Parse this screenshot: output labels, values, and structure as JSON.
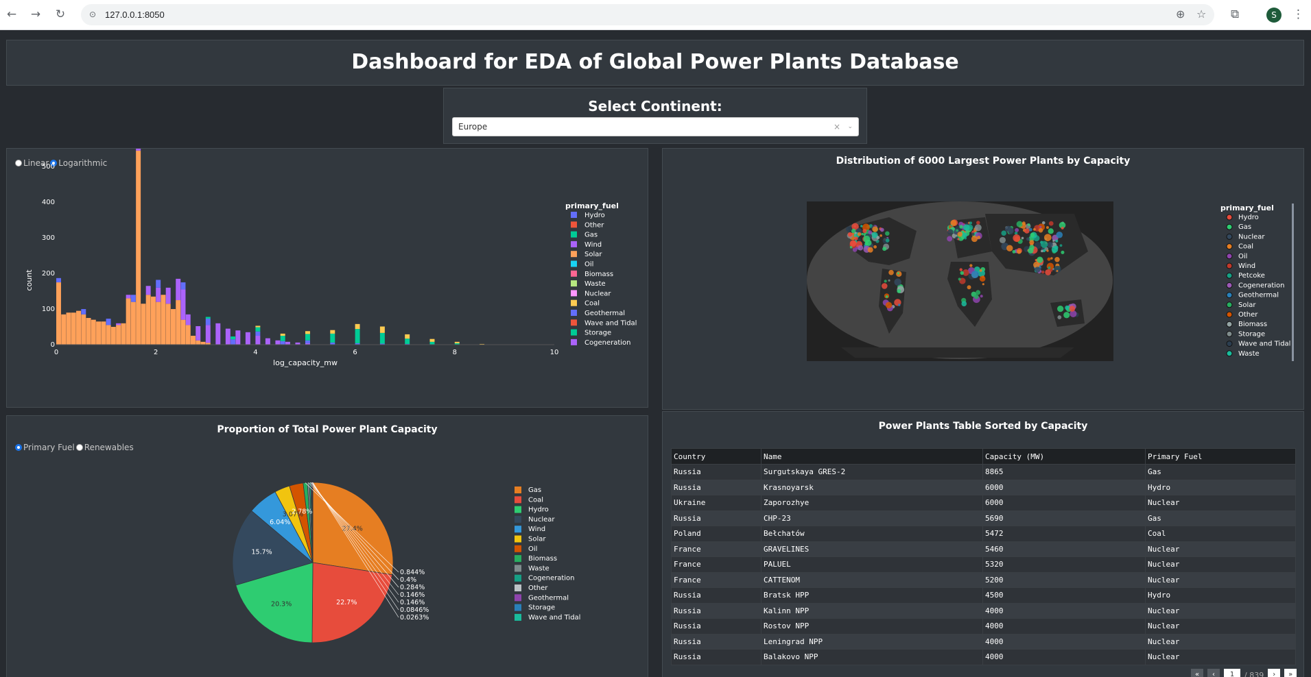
{
  "browser": {
    "url": "127.0.0.1:8050",
    "avatar_letter": "S"
  },
  "header": {
    "title": "Dashboard for EDA of Global Power Plants Database"
  },
  "continent_select": {
    "label": "Select Continent:",
    "value": "Europe",
    "clear": "×",
    "arrow": "⌄"
  },
  "histogram": {
    "radio_options": [
      {
        "label": "Linear",
        "selected": false
      },
      {
        "label": "Logarithmic",
        "selected": true
      }
    ],
    "legend_title": "primary_fuel",
    "xlabel": "log_capacity_mw",
    "ylabel": "count",
    "xticks": [
      "0",
      "2",
      "4",
      "6",
      "8",
      "10"
    ],
    "yticks": [
      "0",
      "100",
      "200",
      "300",
      "400",
      "500"
    ],
    "legend": [
      {
        "name": "Hydro",
        "color": "#636efa"
      },
      {
        "name": "Other",
        "color": "#ef553b"
      },
      {
        "name": "Gas",
        "color": "#00cc96"
      },
      {
        "name": "Wind",
        "color": "#ab63fa"
      },
      {
        "name": "Solar",
        "color": "#ffa15a"
      },
      {
        "name": "Oil",
        "color": "#19d3f3"
      },
      {
        "name": "Biomass",
        "color": "#ff6692"
      },
      {
        "name": "Waste",
        "color": "#b6e880"
      },
      {
        "name": "Nuclear",
        "color": "#ff97ff"
      },
      {
        "name": "Coal",
        "color": "#fecb52"
      },
      {
        "name": "Geothermal",
        "color": "#636efa"
      },
      {
        "name": "Wave and Tidal",
        "color": "#ef553b"
      },
      {
        "name": "Storage",
        "color": "#00cc96"
      },
      {
        "name": "Cogeneration",
        "color": "#ab63fa"
      }
    ]
  },
  "chart_data": [
    {
      "type": "bar",
      "title": "",
      "xlabel": "log_capacity_mw",
      "ylabel": "count",
      "xlim": [
        0,
        10
      ],
      "ylim": [
        0,
        560
      ],
      "bin_width": 0.1,
      "series": [
        {
          "name": "Solar",
          "color": "#ffa15a",
          "bin_starts": [
            0.0,
            0.1,
            0.2,
            0.3,
            0.4,
            0.5,
            0.6,
            0.7,
            0.8,
            0.9,
            1.0,
            1.1,
            1.2,
            1.3,
            1.4,
            1.5,
            1.6,
            1.7,
            1.8,
            1.9,
            2.0,
            2.1,
            2.2,
            2.3,
            2.4,
            2.5,
            2.6,
            2.7,
            2.8,
            2.9,
            3.0
          ],
          "values": [
            175,
            85,
            90,
            90,
            95,
            85,
            75,
            70,
            65,
            65,
            55,
            50,
            55,
            60,
            130,
            120,
            545,
            115,
            140,
            135,
            120,
            140,
            115,
            100,
            125,
            70,
            55,
            25,
            12,
            8,
            5
          ]
        },
        {
          "name": "Wind",
          "color": "#ab63fa",
          "bin_starts": [
            1.2,
            1.4,
            1.6,
            1.8,
            2.0,
            2.2,
            2.4,
            2.5,
            2.6,
            2.8,
            3.0,
            3.2,
            3.4,
            3.6,
            3.8,
            4.0,
            4.2,
            4.4,
            4.6,
            4.8,
            5.0
          ],
          "values": [
            5,
            10,
            10,
            25,
            40,
            45,
            60,
            85,
            30,
            40,
            50,
            60,
            45,
            40,
            35,
            25,
            18,
            12,
            8,
            6,
            4
          ]
        },
        {
          "name": "Hydro",
          "color": "#636efa",
          "bin_starts": [
            0.0,
            0.5,
            1.0,
            1.5,
            2.0,
            2.5,
            3.0,
            3.5,
            4.0,
            4.5,
            5.0,
            5.5,
            6.0,
            6.5,
            7.0
          ],
          "values": [
            12,
            15,
            18,
            20,
            22,
            20,
            18,
            15,
            12,
            10,
            8,
            6,
            4,
            3,
            2
          ]
        },
        {
          "name": "Gas",
          "color": "#00cc96",
          "bin_starts": [
            3.0,
            3.5,
            4.0,
            4.5,
            5.0,
            5.5,
            6.0,
            6.5,
            7.0,
            7.5,
            8.0
          ],
          "values": [
            5,
            8,
            12,
            15,
            18,
            25,
            40,
            30,
            15,
            8,
            4
          ]
        },
        {
          "name": "Coal",
          "color": "#fecb52",
          "bin_starts": [
            4.0,
            4.5,
            5.0,
            5.5,
            6.0,
            6.5,
            7.0,
            7.5,
            8.0,
            8.5
          ],
          "values": [
            4,
            6,
            8,
            10,
            14,
            18,
            12,
            8,
            4,
            2
          ]
        }
      ]
    },
    {
      "type": "pie",
      "title": "Proportion of Total Power Plant Capacity",
      "labels": [
        "Gas",
        "Coal",
        "Hydro",
        "Nuclear",
        "Wind",
        "Solar",
        "Oil",
        "Biomass",
        "Waste",
        "Cogeneration",
        "Other",
        "Geothermal",
        "Storage",
        "Wave and Tidal"
      ],
      "values": [
        27.4,
        22.7,
        20.3,
        15.7,
        6.04,
        3.07,
        2.78,
        0.844,
        0.4,
        0.284,
        0.146,
        0.146,
        0.0846,
        0.0263
      ],
      "value_labels": [
        "27.4%",
        "22.7%",
        "20.3%",
        "15.7%",
        "6.04%",
        "3.07%",
        "2.78%",
        "0.844%",
        "0.4%",
        "0.284%",
        "0.146%",
        "0.146%",
        "0.0846%",
        "0.0263%"
      ],
      "colors": [
        "#e67e22",
        "#e74c3c",
        "#2ecc71",
        "#34495e",
        "#3498db",
        "#f1c40f",
        "#d35400",
        "#27ae60",
        "#7f8c8d",
        "#16a085",
        "#bdc3c7",
        "#8e44ad",
        "#2980b9",
        "#1abc9c"
      ]
    }
  ],
  "map": {
    "title": "Distribution of 6000 Largest Power Plants by Capacity",
    "legend_title": "primary_fuel",
    "legend": [
      {
        "name": "Hydro",
        "color": "#e74c3c"
      },
      {
        "name": "Gas",
        "color": "#2ecc71"
      },
      {
        "name": "Nuclear",
        "color": "#34495e"
      },
      {
        "name": "Coal",
        "color": "#e67e22"
      },
      {
        "name": "Oil",
        "color": "#8e44ad"
      },
      {
        "name": "Wind",
        "color": "#c0392b"
      },
      {
        "name": "Petcoke",
        "color": "#16a085"
      },
      {
        "name": "Cogeneration",
        "color": "#9b59b6"
      },
      {
        "name": "Geothermal",
        "color": "#2980b9"
      },
      {
        "name": "Solar",
        "color": "#27ae60"
      },
      {
        "name": "Other",
        "color": "#d35400"
      },
      {
        "name": "Biomass",
        "color": "#95a5a6"
      },
      {
        "name": "Storage",
        "color": "#7f8c8d"
      },
      {
        "name": "Wave and Tidal",
        "color": "#2c3e50"
      },
      {
        "name": "Waste",
        "color": "#1abc9c"
      }
    ]
  },
  "pie": {
    "title": "Proportion of Total Power Plant Capacity",
    "radio_options": [
      {
        "label": "Primary Fuel",
        "selected": true
      },
      {
        "label": "Renewables",
        "selected": false
      }
    ]
  },
  "table": {
    "title": "Power Plants Table Sorted by Capacity",
    "columns": [
      "Country",
      "Name",
      "Capacity (MW)",
      "Primary Fuel"
    ],
    "rows": [
      [
        "Russia",
        "Surgutskaya GRES-2",
        "8865",
        "Gas"
      ],
      [
        "Russia",
        "Krasnoyarsk",
        "6000",
        "Hydro"
      ],
      [
        "Ukraine",
        "Zaporozhye",
        "6000",
        "Nuclear"
      ],
      [
        "Russia",
        "CHP-23",
        "5690",
        "Gas"
      ],
      [
        "Poland",
        "Bełchatów",
        "5472",
        "Coal"
      ],
      [
        "France",
        "GRAVELINES",
        "5460",
        "Nuclear"
      ],
      [
        "France",
        "PALUEL",
        "5320",
        "Nuclear"
      ],
      [
        "France",
        "CATTENOM",
        "5200",
        "Nuclear"
      ],
      [
        "Russia",
        "Bratsk HPP",
        "4500",
        "Hydro"
      ],
      [
        "Russia",
        "Kalinn NPP",
        "4000",
        "Nuclear"
      ],
      [
        "Russia",
        "Rostov NPP",
        "4000",
        "Nuclear"
      ],
      [
        "Russia",
        "Leningrad NPP",
        "4000",
        "Nuclear"
      ],
      [
        "Russia",
        "Balakovo NPP",
        "4000",
        "Nuclear"
      ]
    ],
    "pager": {
      "current": "1",
      "total": "/ 839"
    }
  }
}
